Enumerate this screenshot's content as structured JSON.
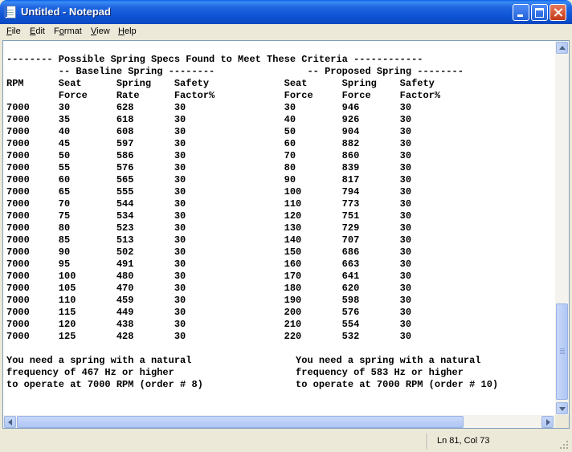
{
  "window": {
    "title": "Untitled - Notepad"
  },
  "menu": {
    "file": {
      "acc": "F",
      "rest": "ile"
    },
    "edit": {
      "acc": "E",
      "rest": "dit"
    },
    "format": {
      "pre": "F",
      "acc": "o",
      "rest": "rmat"
    },
    "view": {
      "acc": "V",
      "rest": "iew"
    },
    "help": {
      "acc": "H",
      "rest": "elp"
    }
  },
  "document": {
    "header": [
      "-------- Possible Spring Specs Found to Meet These Criteria ------------",
      "         -- Baseline Spring --------                -- Proposed Spring --------",
      "RPM      Seat      Spring    Safety             Seat      Spring    Safety",
      "         Force     Rate      Factor%            Force     Force     Factor%"
    ],
    "rows": [
      [
        "7000",
        "30",
        "628",
        "30",
        "30",
        "946",
        "30"
      ],
      [
        "7000",
        "35",
        "618",
        "30",
        "40",
        "926",
        "30"
      ],
      [
        "7000",
        "40",
        "608",
        "30",
        "50",
        "904",
        "30"
      ],
      [
        "7000",
        "45",
        "597",
        "30",
        "60",
        "882",
        "30"
      ],
      [
        "7000",
        "50",
        "586",
        "30",
        "70",
        "860",
        "30"
      ],
      [
        "7000",
        "55",
        "576",
        "30",
        "80",
        "839",
        "30"
      ],
      [
        "7000",
        "60",
        "565",
        "30",
        "90",
        "817",
        "30"
      ],
      [
        "7000",
        "65",
        "555",
        "30",
        "100",
        "794",
        "30"
      ],
      [
        "7000",
        "70",
        "544",
        "30",
        "110",
        "773",
        "30"
      ],
      [
        "7000",
        "75",
        "534",
        "30",
        "120",
        "751",
        "30"
      ],
      [
        "7000",
        "80",
        "523",
        "30",
        "130",
        "729",
        "30"
      ],
      [
        "7000",
        "85",
        "513",
        "30",
        "140",
        "707",
        "30"
      ],
      [
        "7000",
        "90",
        "502",
        "30",
        "150",
        "686",
        "30"
      ],
      [
        "7000",
        "95",
        "491",
        "30",
        "160",
        "663",
        "30"
      ],
      [
        "7000",
        "100",
        "480",
        "30",
        "170",
        "641",
        "30"
      ],
      [
        "7000",
        "105",
        "470",
        "30",
        "180",
        "620",
        "30"
      ],
      [
        "7000",
        "110",
        "459",
        "30",
        "190",
        "598",
        "30"
      ],
      [
        "7000",
        "115",
        "449",
        "30",
        "200",
        "576",
        "30"
      ],
      [
        "7000",
        "120",
        "438",
        "30",
        "210",
        "554",
        "30"
      ],
      [
        "7000",
        "125",
        "428",
        "30",
        "220",
        "532",
        "30"
      ]
    ],
    "footer": [
      "",
      "You need a spring with a natural                  You need a spring with a natural",
      "frequency of 467 Hz or higher                     frequency of 583 Hz or higher",
      "to operate at 7000 RPM (order # 8)                to operate at 7000 RPM (order # 10)"
    ]
  },
  "status": {
    "position": "Ln 81, Col 73"
  }
}
